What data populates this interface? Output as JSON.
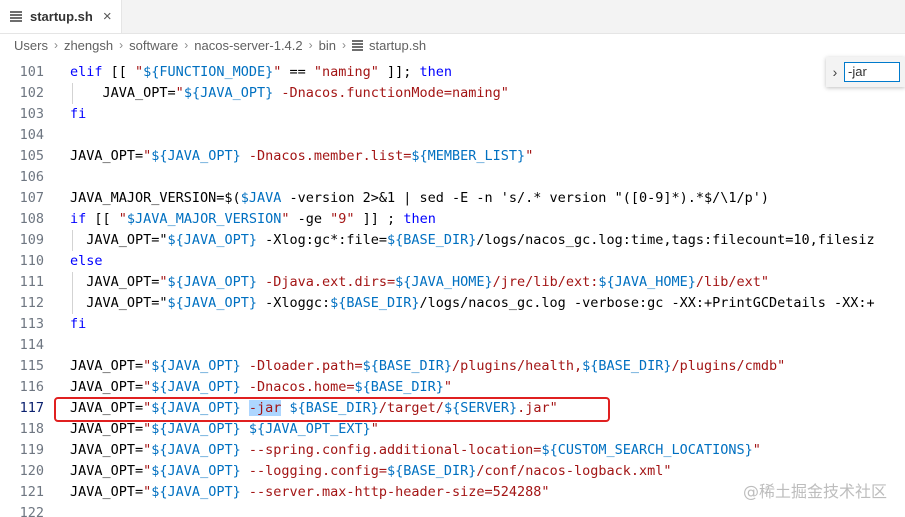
{
  "tab": {
    "title": "startup.sh",
    "close": "×",
    "icon": "file-lines-icon"
  },
  "breadcrumbs": {
    "items": [
      "Users",
      "zhengsh",
      "software",
      "nacos-server-1.4.2",
      "bin",
      "startup.sh"
    ],
    "separator": "›"
  },
  "find": {
    "toggle": "›",
    "value": "-jar"
  },
  "red_box_line": "117",
  "lines": [
    {
      "num": "101",
      "code": "elif [[ \"${FUNCTION_MODE}\" == \"naming\" ]]; then"
    },
    {
      "num": "102",
      "code": "    JAVA_OPT=\"${JAVA_OPT} -Dnacos.functionMode=naming\""
    },
    {
      "num": "103",
      "code": "fi"
    },
    {
      "num": "104",
      "code": ""
    },
    {
      "num": "105",
      "code": "JAVA_OPT=\"${JAVA_OPT} -Dnacos.member.list=${MEMBER_LIST}\""
    },
    {
      "num": "106",
      "code": ""
    },
    {
      "num": "107",
      "code": "JAVA_MAJOR_VERSION=$($JAVA -version 2>&1 | sed -E -n 's/.* version \"([0-9]*).*$/\\1/p')"
    },
    {
      "num": "108",
      "code": "if [[ \"$JAVA_MAJOR_VERSION\" -ge \"9\" ]] ; then"
    },
    {
      "num": "109",
      "code": "  JAVA_OPT=\"${JAVA_OPT} -Xlog:gc*:file=${BASE_DIR}/logs/nacos_gc.log:time,tags:filecount=10,filesiz"
    },
    {
      "num": "110",
      "code": "else"
    },
    {
      "num": "111",
      "code": "  JAVA_OPT=\"${JAVA_OPT} -Djava.ext.dirs=${JAVA_HOME}/jre/lib/ext:${JAVA_HOME}/lib/ext\""
    },
    {
      "num": "112",
      "code": "  JAVA_OPT=\"${JAVA_OPT} -Xloggc:${BASE_DIR}/logs/nacos_gc.log -verbose:gc -XX:+PrintGCDetails -XX:+"
    },
    {
      "num": "113",
      "code": "fi"
    },
    {
      "num": "114",
      "code": ""
    },
    {
      "num": "115",
      "code": "JAVA_OPT=\"${JAVA_OPT} -Dloader.path=${BASE_DIR}/plugins/health,${BASE_DIR}/plugins/cmdb\""
    },
    {
      "num": "116",
      "code": "JAVA_OPT=\"${JAVA_OPT} -Dnacos.home=${BASE_DIR}\""
    },
    {
      "num": "117",
      "code": "JAVA_OPT=\"${JAVA_OPT} -jar ${BASE_DIR}/target/${SERVER}.jar\""
    },
    {
      "num": "118",
      "code": "JAVA_OPT=\"${JAVA_OPT} ${JAVA_OPT_EXT}\""
    },
    {
      "num": "119",
      "code": "JAVA_OPT=\"${JAVA_OPT} --spring.config.additional-location=${CUSTOM_SEARCH_LOCATIONS}\""
    },
    {
      "num": "120",
      "code": "JAVA_OPT=\"${JAVA_OPT} --logging.config=${BASE_DIR}/conf/nacos-logback.xml\""
    },
    {
      "num": "121",
      "code": "JAVA_OPT=\"${JAVA_OPT} --server.max-http-header-size=524288\""
    },
    {
      "num": "122",
      "code": ""
    }
  ],
  "watermark": "@稀土掘金技术社区"
}
